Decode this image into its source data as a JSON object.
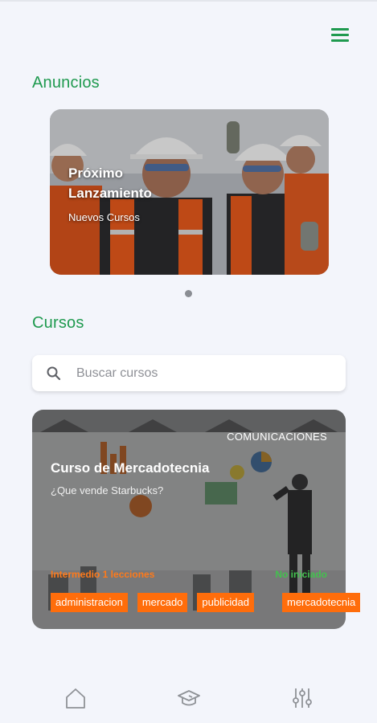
{
  "header": {
    "menu_icon": "hamburger-menu-icon",
    "accent": "#1f9a4f"
  },
  "announcements": {
    "section_title": "Anuncios",
    "items": [
      {
        "title": "Próximo Lanzamiento",
        "subtitle": "Nuevos Cursos",
        "image": "workers-photo"
      }
    ],
    "active_page": 1,
    "page_count": 1
  },
  "courses": {
    "section_title": "Cursos",
    "search": {
      "placeholder": "Buscar cursos",
      "value": "",
      "icon": "search-icon"
    },
    "items": [
      {
        "category": "COMUNICACIONES",
        "title": "Curso de Mercadotecnia",
        "subtitle": "¿Que vende Starbucks?",
        "level": "Intermedio 1 lecciones",
        "status": "No iniciado",
        "tags": [
          "administracion",
          "mercado",
          "publicidad",
          "mercadotecnia"
        ],
        "image": "marketing-whiteboard-photo"
      }
    ]
  },
  "colors": {
    "level": "#ff7a1a",
    "status": "#43c14e",
    "tag_bg": "#ff6d0b"
  },
  "bottom_nav": [
    {
      "name": "home",
      "icon": "home-icon"
    },
    {
      "name": "courses",
      "icon": "graduation-cap-icon"
    },
    {
      "name": "settings",
      "icon": "sliders-icon"
    }
  ]
}
